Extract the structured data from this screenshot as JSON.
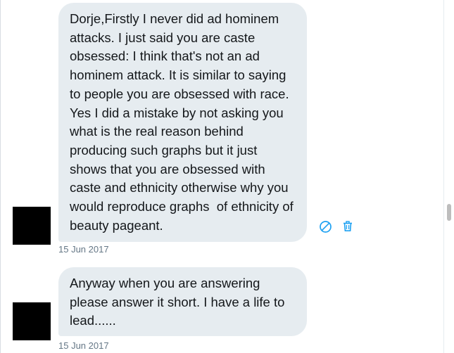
{
  "messages": [
    {
      "text": "Dorje,Firstly I never did ad hominem attacks. I just said you are caste obsessed: I think that's not an ad hominem attack. It is similar to saying to people you are obsessed with race. Yes I did a mistake by not asking you what is the real reason behind producing such graphs but it just shows that you are obsessed with caste and ethnicity otherwise why you would reproduce graphs  of ethnicity of beauty pageant.",
      "timestamp": "15 Jun 2017"
    },
    {
      "text": "Anyway when you are answering please answer it short. I have a life to lead......",
      "timestamp": "15 Jun 2017"
    }
  ],
  "icons": {
    "report": "block-icon",
    "delete": "trash-icon"
  },
  "colors": {
    "bubble_bg": "#e6ecf0",
    "text": "#14171a",
    "timestamp": "#657786",
    "icon_accent": "#1da1f2"
  }
}
